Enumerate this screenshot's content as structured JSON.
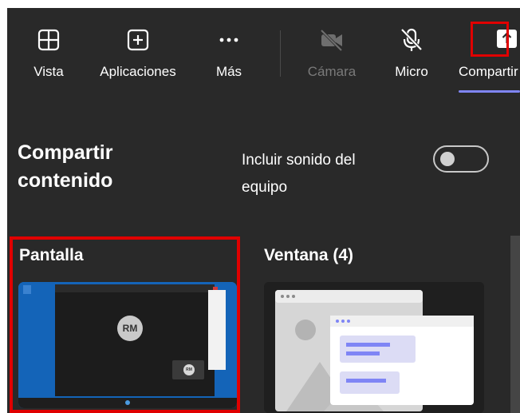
{
  "toolbar": {
    "vista_label": "Vista",
    "apps_label": "Aplicaciones",
    "more_label": "Más",
    "camera_label": "Cámara",
    "mic_label": "Micro",
    "share_label": "Compartir"
  },
  "panel": {
    "title": "Compartir contenido",
    "sound_label": "Incluir sonido del equipo",
    "sound_enabled": false
  },
  "options": {
    "screen_label": "Pantalla",
    "window_label": "Ventana (4)"
  },
  "thumbnail": {
    "avatar_initials": "RM",
    "mini_avatar_initials": "RM"
  },
  "colors": {
    "background": "#292929",
    "accent": "#7f85f5",
    "highlight_border": "#e00000",
    "desktop_blue": "#1464b8"
  }
}
